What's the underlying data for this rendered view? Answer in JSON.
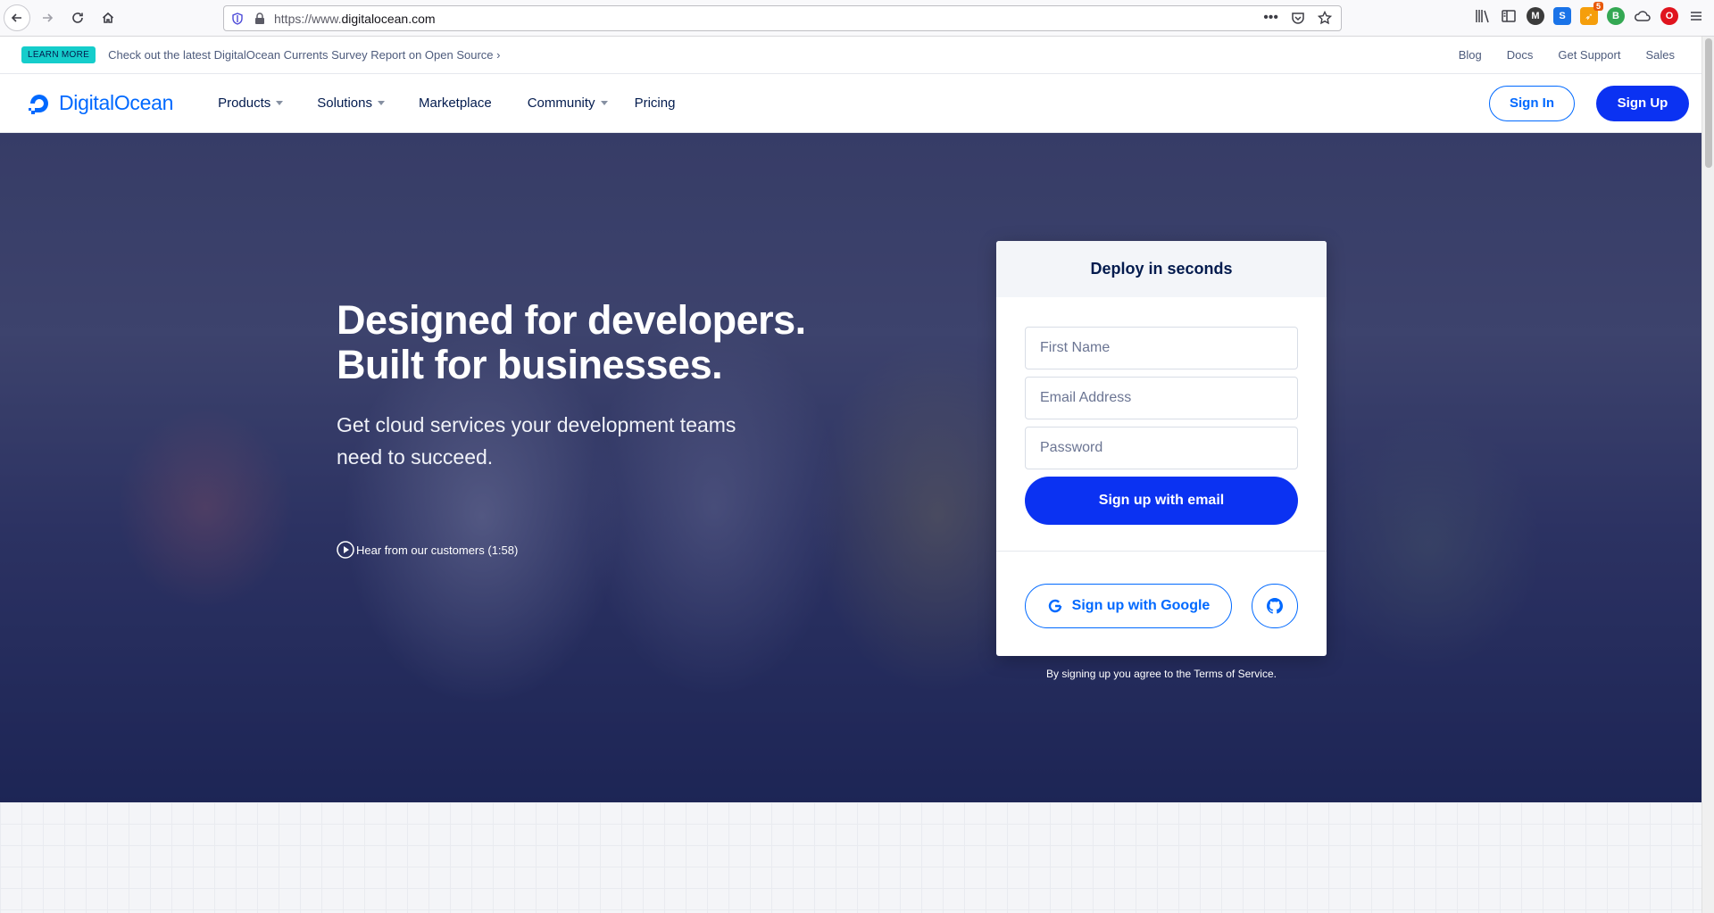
{
  "browser": {
    "url_prefix": "https://www.",
    "url_domain": "digitalocean.com",
    "extension_badge": "5",
    "extensions": [
      "library-icon",
      "sidebar-icon",
      "m-extension-icon",
      "s-extension-icon",
      "rocket-extension-icon",
      "b-extension-icon",
      "cloud-icon",
      "opera-icon",
      "menu-icon"
    ]
  },
  "announcement": {
    "badge": "LEARN MORE",
    "text": "Check out the latest DigitalOcean Currents Survey Report on Open Source",
    "arrow": "›",
    "links": [
      "Blog",
      "Docs",
      "Get Support",
      "Sales"
    ]
  },
  "nav": {
    "logo": "DigitalOcean",
    "items": [
      {
        "label": "Products",
        "dropdown": true
      },
      {
        "label": "Solutions",
        "dropdown": true
      },
      {
        "label": "Marketplace",
        "dropdown": false
      },
      {
        "label": "Community",
        "dropdown": true
      },
      {
        "label": "Pricing",
        "dropdown": false
      }
    ],
    "sign_in": "Sign In",
    "sign_up": "Sign Up"
  },
  "hero": {
    "title_line1": "Designed for developers.",
    "title_line2": "Built for businesses.",
    "subtitle": "Get cloud services your development teams need to succeed.",
    "video_link": "Hear from our customers (1:58)"
  },
  "signup_card": {
    "heading": "Deploy in seconds",
    "first_name_placeholder": "First Name",
    "email_placeholder": "Email Address",
    "password_placeholder": "Password",
    "email_button": "Sign up with email",
    "google_button": "Sign up with Google",
    "terms": "By signing up you agree to the Terms of Service."
  },
  "colors": {
    "brand_blue": "#0069ff",
    "cta_blue": "#0b32f2",
    "badge_teal": "#15cdcb",
    "navy_text": "#031b4e"
  }
}
